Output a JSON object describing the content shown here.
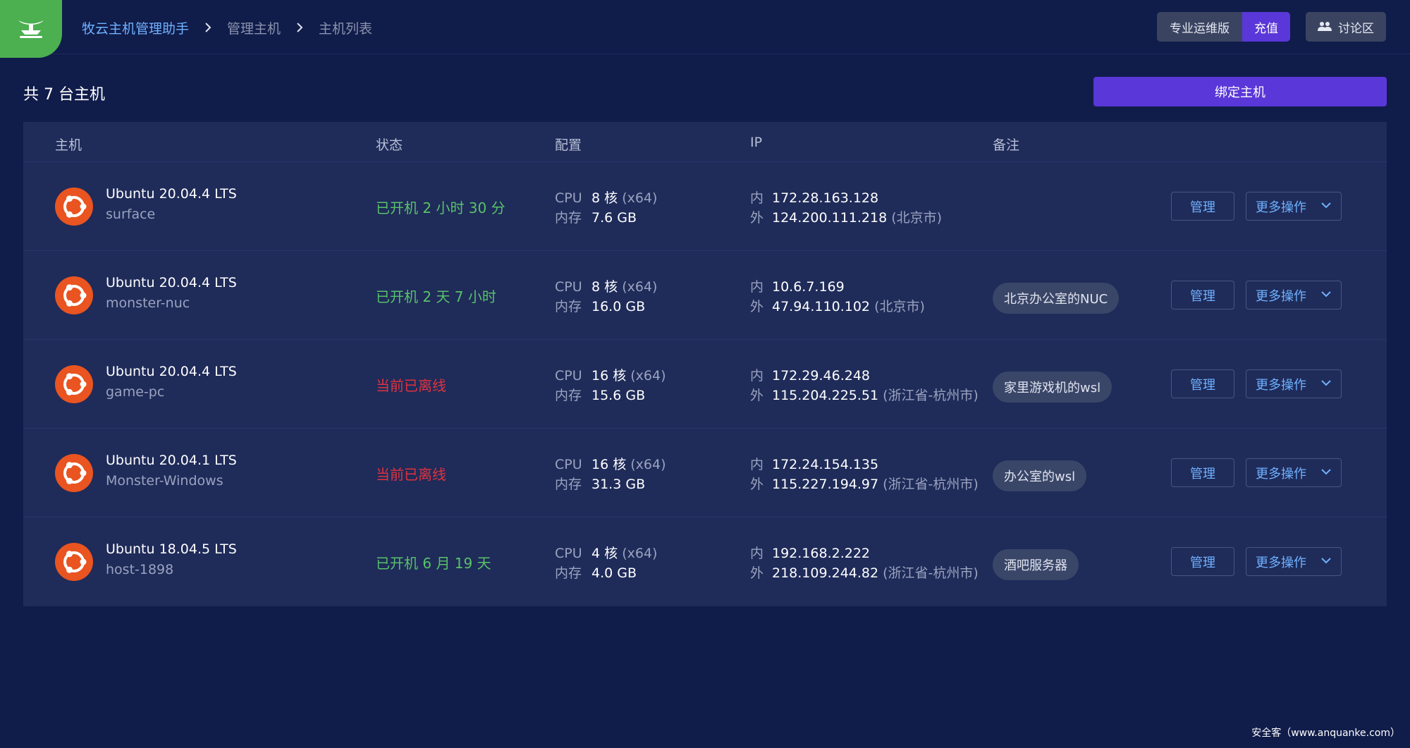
{
  "breadcrumb": [
    "牧云主机管理助手",
    "管理主机",
    "主机列表"
  ],
  "header": {
    "plan_label": "专业运维版",
    "recharge_label": "充值",
    "forum_label": "讨论区"
  },
  "page": {
    "count_title": "共 7 台主机",
    "bind_label": "绑定主机"
  },
  "table": {
    "headers": [
      "主机",
      "状态",
      "配置",
      "IP",
      "备注"
    ],
    "cpu_label": "CPU",
    "mem_label": "内存",
    "inner_label": "内",
    "outer_label": "外",
    "manage_label": "管理",
    "more_label": "更多操作",
    "rows": [
      {
        "os": "Ubuntu 20.04.4 LTS",
        "host": "surface",
        "status": "已开机 2 小时 30 分",
        "status_type": "online",
        "cpu": "8 核",
        "arch": "(x64)",
        "mem": "7.6 GB",
        "ip_in": "172.28.163.128",
        "ip_out": "124.200.111.218",
        "loc": "(北京市)",
        "note": ""
      },
      {
        "os": "Ubuntu 20.04.4 LTS",
        "host": "monster-nuc",
        "status": "已开机 2 天 7 小时",
        "status_type": "online",
        "cpu": "8 核",
        "arch": "(x64)",
        "mem": "16.0 GB",
        "ip_in": "10.6.7.169",
        "ip_out": "47.94.110.102",
        "loc": "(北京市)",
        "note": "北京办公室的NUC"
      },
      {
        "os": "Ubuntu 20.04.4 LTS",
        "host": "game-pc",
        "status": "当前已离线",
        "status_type": "offline",
        "cpu": "16 核",
        "arch": "(x64)",
        "mem": "15.6 GB",
        "ip_in": "172.29.46.248",
        "ip_out": "115.204.225.51",
        "loc": "(浙江省-杭州市)",
        "note": "家里游戏机的wsl"
      },
      {
        "os": "Ubuntu 20.04.1 LTS",
        "host": "Monster-Windows",
        "status": "当前已离线",
        "status_type": "offline",
        "cpu": "16 核",
        "arch": "(x64)",
        "mem": "31.3 GB",
        "ip_in": "172.24.154.135",
        "ip_out": "115.227.194.97",
        "loc": "(浙江省-杭州市)",
        "note": "办公室的wsl"
      },
      {
        "os": "Ubuntu 18.04.5 LTS",
        "host": "host-1898",
        "status": "已开机 6 月 19 天",
        "status_type": "online",
        "cpu": "4 核",
        "arch": "(x64)",
        "mem": "4.0 GB",
        "ip_in": "192.168.2.222",
        "ip_out": "218.109.244.82",
        "loc": "(浙江省-杭州市)",
        "note": "酒吧服务器"
      }
    ]
  },
  "watermark": "安全客（www.anquanke.com）",
  "colors": {
    "background": "#101c4a",
    "table": "#1f2b59",
    "accent": "#5a37d8",
    "logo": "#4caf50",
    "online": "#58c26a",
    "offline": "#e0323f",
    "link": "#6fb1ff",
    "ubuntu": "#e95420"
  }
}
